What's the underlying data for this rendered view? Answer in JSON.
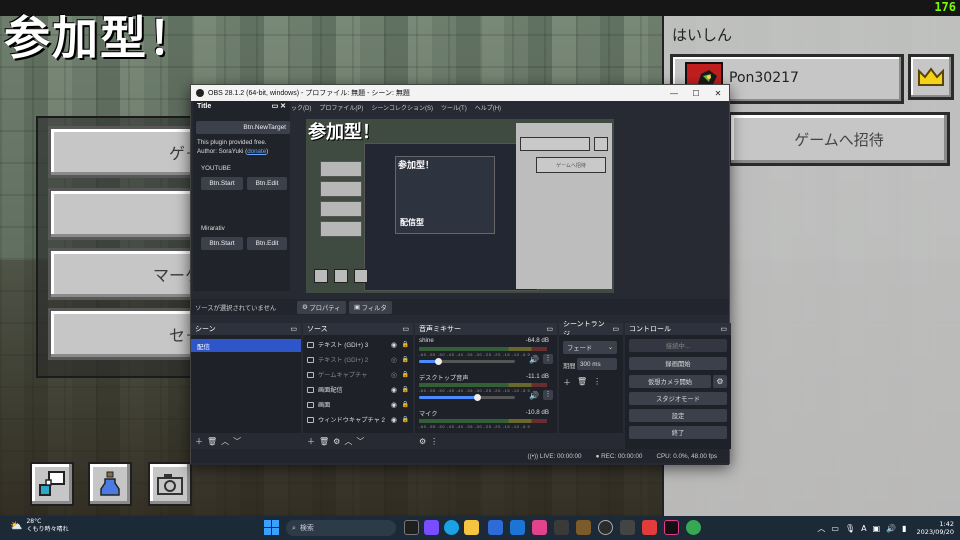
{
  "stream": {
    "title": "参加型！",
    "fps": "176"
  },
  "minecraft": {
    "menu_buttons": [
      "ゲ－",
      "",
      "マーケ",
      "セ－"
    ],
    "right_panel": {
      "title": "はいしん",
      "friend_name": "Pon30217",
      "invite_label": "ゲームへ招待"
    },
    "bottom_icons": [
      "chat-bubble-icon",
      "potion-icon",
      "camera-icon"
    ]
  },
  "obs": {
    "title": "OBS 28.1.2 (64-bit, windows) - プロファイル: 無題 - シーン: 無題",
    "menu": [
      "ック(D)",
      "プロファイル(P)",
      "シーンコレクション(S)",
      "ツール(T)",
      "ヘルプ(H)"
    ],
    "plugin_dock": {
      "title": "Title",
      "target_button": "Btn.NewTarget",
      "info_line1": "This plugin provided free.",
      "info_author": "Author: SoraYuki (",
      "info_link": "donate",
      "info_close": ")",
      "section_youtube": "YOUTUBE",
      "section_mirrativ": "Mirarativ",
      "start_label": "Btn.Start",
      "edit_label": "Btn.Edit"
    },
    "preview": {
      "title": "参加型！",
      "inner_title": "参加型！",
      "inner_label": "配信型"
    },
    "status": {
      "no_source": "ソースが選択されていません",
      "properties": "プロパティ",
      "filter": "フィルタ"
    },
    "scenes": {
      "title": "シーン",
      "items": [
        "配信"
      ]
    },
    "sources": {
      "title": "ソース",
      "items": [
        {
          "label": "テキスト (GDI+) 3",
          "dim": false
        },
        {
          "label": "テキスト (GDI+) 2",
          "dim": true
        },
        {
          "label": "ゲームキャプチャ",
          "dim": true
        },
        {
          "label": "画面配信",
          "dim": false
        },
        {
          "label": "画面",
          "dim": false
        },
        {
          "label": "ウィンドウキャプチャ 2",
          "dim": false
        }
      ]
    },
    "mixer": {
      "title": "音声ミキサー",
      "ticks": "-60 -55 -50 -45 -40 -35 -30 -25 -20 -15 -10 -5 0",
      "channels": [
        {
          "name": "shine",
          "db": "-64.8 dB",
          "level": 0.2
        },
        {
          "name": "デスクトップ音声",
          "db": "-11.1 dB",
          "level": 0.6
        },
        {
          "name": "マイク",
          "db": "-10.8 dB",
          "level": 0.55
        }
      ]
    },
    "transitions": {
      "title": "シーントランジ...",
      "selected": "フェード",
      "duration_label": "期間",
      "duration_value": "300 ms"
    },
    "controls": {
      "title": "コントロール",
      "buttons": [
        "接続中...",
        "録画開始",
        "仮想カメラ開始",
        "スタジオモード",
        "設定",
        "終了"
      ]
    },
    "statusbar": {
      "live": "LIVE: 00:00:00",
      "rec": "REC: 00:00:00",
      "cpu": "CPU: 0.0%, 48.00 fps"
    }
  },
  "taskbar": {
    "weather_temp": "28°C",
    "weather_desc": "くもり時々晴れ",
    "search_placeholder": "検索",
    "tray_lang": "A",
    "time": "1:42",
    "date": "2023/09/20"
  }
}
